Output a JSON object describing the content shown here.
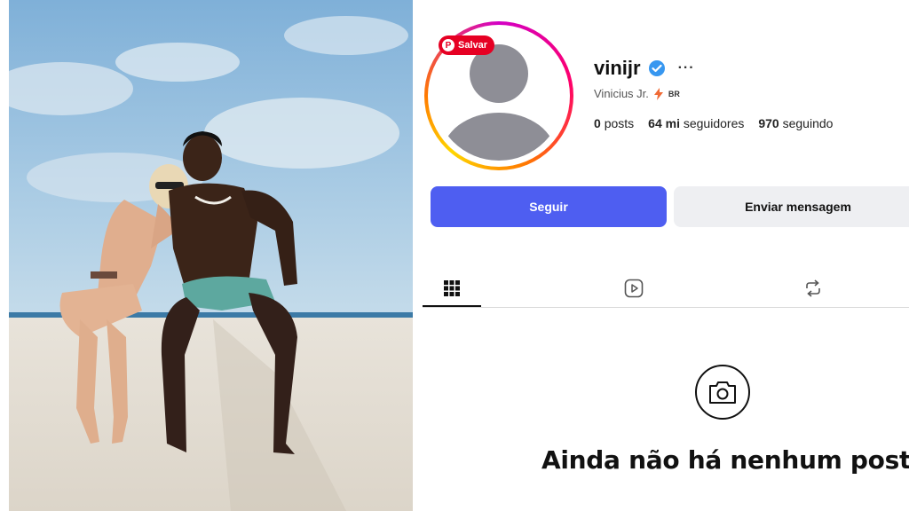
{
  "profile": {
    "username": "vinijr",
    "full_name": "Vinicius Jr.",
    "country": "BR",
    "verified": true,
    "stats": {
      "posts_value": "0",
      "posts_label": "posts",
      "followers_value": "64 mi",
      "followers_label": "seguidores",
      "following_value": "970",
      "following_label": "seguindo"
    }
  },
  "save_badge": {
    "label": "Salvar",
    "color": "#e60023"
  },
  "buttons": {
    "follow": "Seguir",
    "message": "Enviar mensagem"
  },
  "tabs": [
    {
      "icon": "grid-icon",
      "active": true
    },
    {
      "icon": "reels-icon",
      "active": false
    },
    {
      "icon": "repost-icon",
      "active": false
    }
  ],
  "empty_state": {
    "icon": "camera-icon",
    "title": "Ainda não há nenhum post"
  },
  "colors": {
    "accent": "#4e5ef1",
    "verified": "#3797f0",
    "lightning": "#f06a35"
  }
}
